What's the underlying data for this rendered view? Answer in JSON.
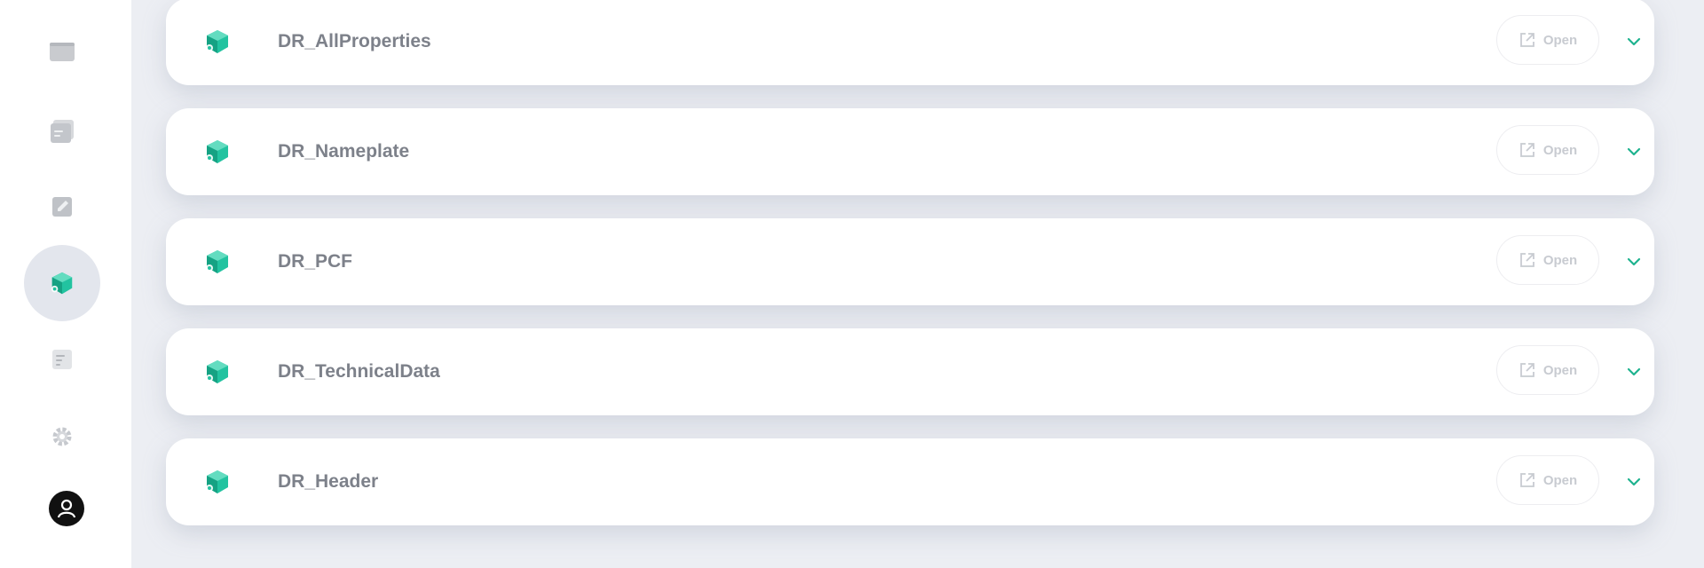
{
  "sidebar": {
    "items": [
      {
        "icon": "folder-icon",
        "active": false
      },
      {
        "icon": "document-stack-icon",
        "active": false
      },
      {
        "icon": "edit-icon",
        "active": false
      },
      {
        "icon": "cube-icon",
        "active": true
      },
      {
        "icon": "list-document-icon",
        "active": false
      },
      {
        "icon": "gear-icon",
        "active": false
      }
    ],
    "user_icon": "user-avatar-icon"
  },
  "cards": [
    {
      "title": "DR_AllProperties",
      "open_label": "Open"
    },
    {
      "title": "DR_Nameplate",
      "open_label": "Open"
    },
    {
      "title": "DR_PCF",
      "open_label": "Open"
    },
    {
      "title": "DR_TechnicalData",
      "open_label": "Open"
    },
    {
      "title": "DR_Header",
      "open_label": "Open"
    }
  ],
  "colors": {
    "accent": "#1fb38f",
    "title_text": "#7d818a",
    "muted": "#c8cbd1",
    "background": "#eceef3"
  }
}
